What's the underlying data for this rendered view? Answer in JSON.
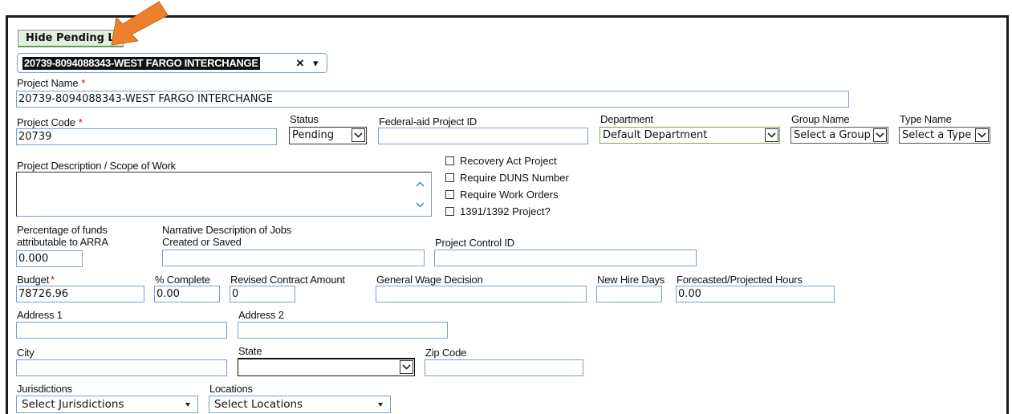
{
  "pending_button": {
    "label": "Hide Pending List"
  },
  "project_picker": {
    "value": "20739-8094088343-WEST FARGO INTERCHANGE",
    "clear": "×",
    "caret": "▾"
  },
  "project_name": {
    "label": "Project Name",
    "req": "*",
    "value": "20739-8094088343-WEST FARGO INTERCHANGE"
  },
  "project_code": {
    "label": "Project Code",
    "req": "*",
    "value": "20739"
  },
  "status": {
    "label": "Status",
    "value": "Pending"
  },
  "federal_aid": {
    "label": "Federal-aid Project ID",
    "value": ""
  },
  "department": {
    "label": "Department",
    "value": "Default Department"
  },
  "group_name": {
    "label": "Group Name",
    "value": "Select a Group"
  },
  "type_name": {
    "label": "Type Name",
    "value": "Select a Type"
  },
  "description": {
    "label": "Project Description / Scope of Work",
    "value": ""
  },
  "checkboxes": [
    {
      "label": "Recovery Act Project",
      "checked": false
    },
    {
      "label": "Require DUNS Number",
      "checked": false
    },
    {
      "label": "Require Work Orders",
      "checked": false
    },
    {
      "label": "1391/1392 Project?",
      "checked": false
    }
  ],
  "arra_pct": {
    "label_line1": "Percentage of funds",
    "label_line2": "attributable to ARRA",
    "value": "0.000"
  },
  "narrative": {
    "label_line1": "Narrative Description of Jobs",
    "label_line2": "Created or Saved",
    "value": ""
  },
  "control_id": {
    "label": "Project Control ID",
    "value": ""
  },
  "budget": {
    "label": "Budget",
    "req": "*",
    "value": "78726.96"
  },
  "pct_complete": {
    "label": "% Complete",
    "value": "0.00"
  },
  "revised_amount": {
    "label": "Revised Contract Amount",
    "value": "0"
  },
  "wage_decision": {
    "label": "General Wage Decision",
    "value": ""
  },
  "new_hire_days": {
    "label": "New Hire Days",
    "value": ""
  },
  "forecast_hours": {
    "label": "Forecasted/Projected Hours",
    "value": "0.00"
  },
  "address1": {
    "label": "Address 1",
    "value": ""
  },
  "address2": {
    "label": "Address 2",
    "value": ""
  },
  "city": {
    "label": "City",
    "value": ""
  },
  "state": {
    "label": "State",
    "value": ""
  },
  "zip": {
    "label": "Zip Code",
    "value": ""
  },
  "jurisdictions": {
    "label": "Jurisdictions",
    "value": "Select Jurisdictions"
  },
  "locations": {
    "label": "Locations",
    "value": "Select Locations"
  },
  "colors": {
    "arrow": "#ee7f2d",
    "input_border": "#7b9ec9",
    "button_bg": "#dff0dc",
    "required": "#cc0000"
  }
}
